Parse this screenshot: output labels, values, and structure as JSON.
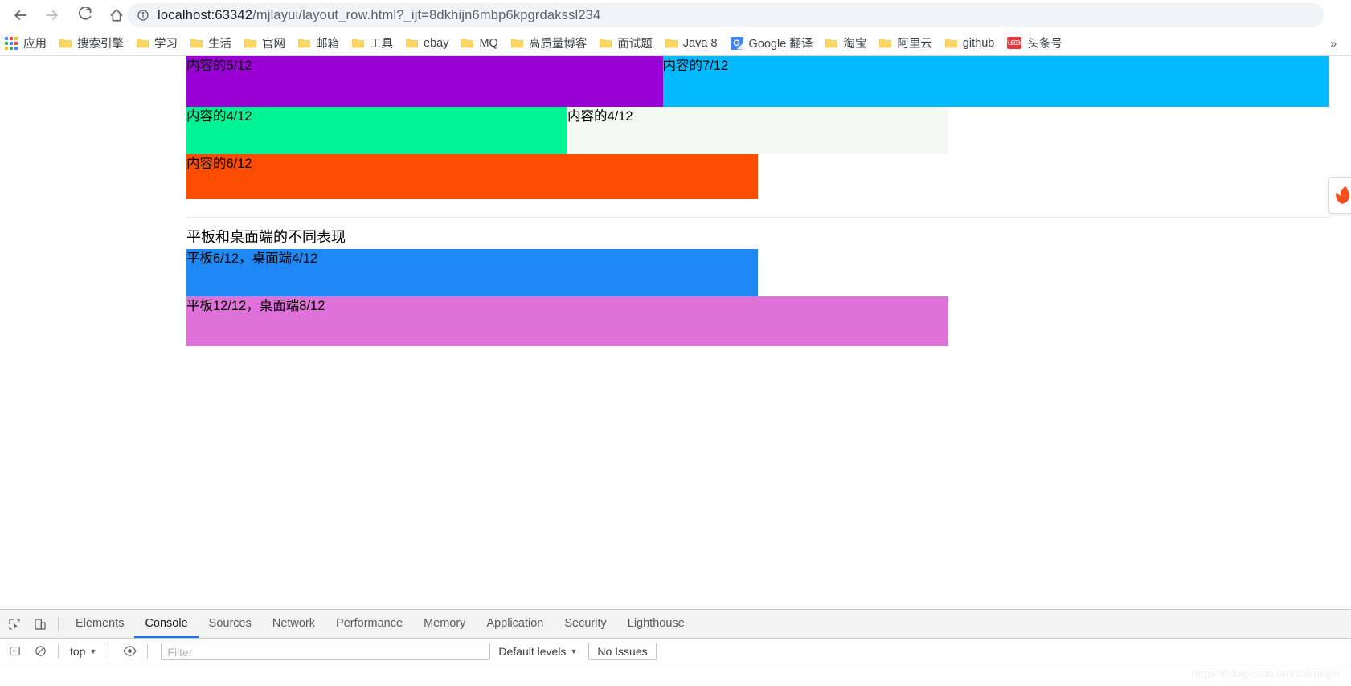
{
  "browser": {
    "url_prefix": "localhost:63342",
    "url_rest": "/mjlayui/layout_row.html?_ijt=8dkhijn6mbp6kpgrdakssl234",
    "back_icon": "back-arrow-icon",
    "forward_icon": "forward-arrow-icon",
    "reload_icon": "reload-icon",
    "home_icon": "home-icon",
    "info_icon": "page-info-icon",
    "overflow_label": "»"
  },
  "bookmarks": {
    "apps_label": "应用",
    "items": [
      {
        "label": "搜索引擎",
        "icon": "folder-icon"
      },
      {
        "label": "学习",
        "icon": "folder-icon"
      },
      {
        "label": "生活",
        "icon": "folder-icon"
      },
      {
        "label": "官网",
        "icon": "folder-icon"
      },
      {
        "label": "邮箱",
        "icon": "folder-icon"
      },
      {
        "label": "工具",
        "icon": "folder-icon"
      },
      {
        "label": "ebay",
        "icon": "folder-icon"
      },
      {
        "label": "MQ",
        "icon": "folder-icon"
      },
      {
        "label": "高质量博客",
        "icon": "folder-icon"
      },
      {
        "label": "面试题",
        "icon": "folder-icon"
      },
      {
        "label": "Java 8",
        "icon": "folder-icon"
      },
      {
        "label": "Google 翻译",
        "icon": "google-translate-icon"
      },
      {
        "label": "淘宝",
        "icon": "folder-icon"
      },
      {
        "label": "阿里云",
        "icon": "folder-icon"
      },
      {
        "label": "github",
        "icon": "folder-icon"
      },
      {
        "label": "头条号",
        "icon": "toutiao-icon"
      }
    ]
  },
  "page": {
    "grid_row1": [
      {
        "label": "内容的5/12",
        "cols": 5,
        "color": "#9900d4"
      },
      {
        "label": "内容的7/12",
        "cols": 7,
        "color": "#00b9ff"
      }
    ],
    "grid_row2": [
      {
        "label": "内容的4/12",
        "cols": 4,
        "color": "#00f294"
      },
      {
        "label": "内容的4/12",
        "cols": 4,
        "color": "#f2faf2"
      }
    ],
    "grid_row3": [
      {
        "label": "内容的6/12",
        "cols": 6,
        "color": "#ff4d00"
      }
    ],
    "section_title": "平板和桌面端的不同表现",
    "grid_row4": [
      {
        "label": "平板6/12，桌面端4/12",
        "cols": 6,
        "color": "#2088f5"
      }
    ],
    "grid_row5": [
      {
        "label": "平板12/12，桌面端8/12",
        "cols": 8,
        "color": "#de72d9"
      }
    ],
    "side_widget_icon": "feedback-widget-icon"
  },
  "devtools": {
    "inspect_icon": "inspect-element-icon",
    "device_icon": "device-toolbar-icon",
    "tabs": [
      {
        "label": "Elements",
        "active": false
      },
      {
        "label": "Console",
        "active": true
      },
      {
        "label": "Sources",
        "active": false
      },
      {
        "label": "Network",
        "active": false
      },
      {
        "label": "Performance",
        "active": false
      },
      {
        "label": "Memory",
        "active": false
      },
      {
        "label": "Application",
        "active": false
      },
      {
        "label": "Security",
        "active": false
      },
      {
        "label": "Lighthouse",
        "active": false
      }
    ],
    "console": {
      "execute_icon": "sidebar-toggle-icon",
      "clear_icon": "clear-console-icon",
      "context": "top",
      "eye_icon": "live-expression-icon",
      "filter_placeholder": "Filter",
      "levels_label": "Default levels",
      "issues_label": "No Issues"
    }
  },
  "watermark": "https://blog.csdn.net/daimeijin"
}
